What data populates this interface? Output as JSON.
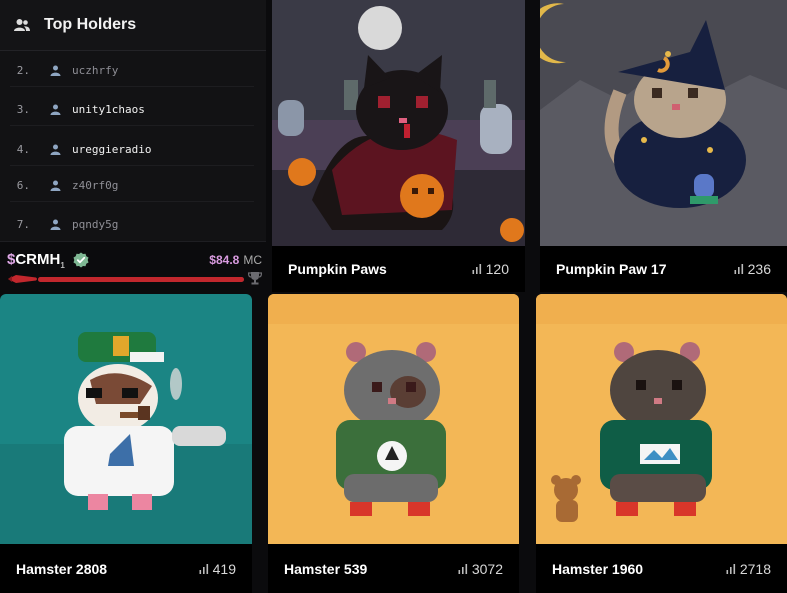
{
  "top_holders": {
    "title": "Top Holders",
    "header_icon": "users-icon",
    "rows": [
      {
        "rank": "2.",
        "name": "uczhrfy",
        "highlight": false
      },
      {
        "rank": "3.",
        "name": "unity1chaos",
        "highlight": true
      },
      {
        "rank": "4.",
        "name": "ureggieradio",
        "highlight": true
      },
      {
        "rank": "6.",
        "name": "z40rf0g",
        "highlight": false
      },
      {
        "rank": "7.",
        "name": "pqndy5g",
        "highlight": false
      }
    ]
  },
  "token": {
    "dollar": "$",
    "symbol": "CRMH",
    "sub": "1",
    "market_cap": "$84.8",
    "mc_label": "MC",
    "progress_fraction": 1.0,
    "colors": {
      "dollar": "#e0a8e8",
      "market_cap": "#d99be0",
      "progress": "#c2272d"
    }
  },
  "cards": [
    {
      "name": "Pumpkin Paws",
      "count": "120"
    },
    {
      "name": "Pumpkin Paw 17",
      "count": "236"
    },
    {
      "name": "Hamster 2808",
      "count": "419"
    },
    {
      "name": "Hamster 539",
      "count": "3072"
    },
    {
      "name": "Hamster 1960",
      "count": "2718"
    }
  ],
  "icons": {
    "verified": "verified-check-icon",
    "rocket": "rocket-icon",
    "trophy": "trophy-icon",
    "stat": "bar-chart-icon",
    "user": "user-icon"
  }
}
